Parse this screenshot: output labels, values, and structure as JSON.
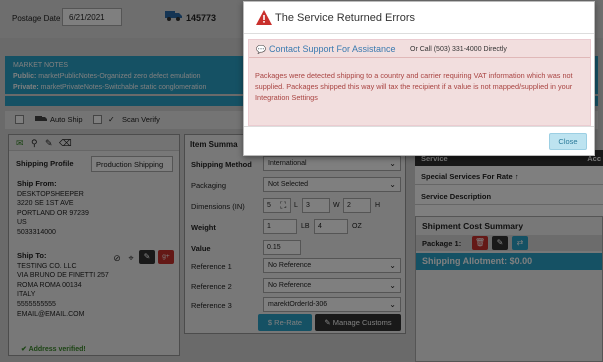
{
  "header": {
    "postage_date_label": "Postage Date",
    "postage_date_value": "6/21/2021",
    "order_number": "145773"
  },
  "market_notes": {
    "title": "MARKET NOTES",
    "public_label": "Public:",
    "public_text": "marketPublicNotes-Organized zero defect emulation",
    "private_label": "Private:",
    "private_text": "marketPrivateNotes-Switchable static conglomeration"
  },
  "options": {
    "auto_ship": "Auto Ship",
    "scan_verify": "Scan Verify"
  },
  "shipping": {
    "profile_label": "Shipping Profile",
    "profile_value": "Production Shipping",
    "ship_from_label": "Ship From:",
    "ship_from_lines": [
      "DESKTOPSHEEPER",
      "3220 SE 1ST AVE",
      "PORTLAND OR 97239",
      "US",
      "5033314000"
    ],
    "ship_to_label": "Ship To:",
    "ship_to_lines": [
      "TESTING CO. LLC",
      "VIA BRUNO DE FINETTI 257",
      "ROMA ROMA 00134",
      "ITALY",
      "5555555555",
      "EMAIL@EMAIL.COM"
    ],
    "verified_text": "Address verified!"
  },
  "item_summary": {
    "title": "Item Summa",
    "shipping_method_label": "Shipping Method",
    "shipping_method_value": "International",
    "packaging_label": "Packaging",
    "packaging_value": "Not Selected",
    "dimensions_label": "Dimensions (IN)",
    "dim_s": "5",
    "dim_l_label": "L",
    "dim_l": "3",
    "dim_w_label": "W",
    "dim_w": "2",
    "dim_h_label": "H",
    "weight_label": "Weight",
    "weight_lb": "1",
    "lb_label": "LB",
    "weight_oz": "4",
    "oz_label": "OZ",
    "value_label": "Value",
    "value_value": "0.15",
    "ref1_label": "Reference 1",
    "ref1_value": "No Reference",
    "ref2_label": "Reference 2",
    "ref2_value": "No Reference",
    "ref3_label": "Reference 3",
    "ref3_value": "marektOrderId-306",
    "rerate_label": "$ Re-Rate",
    "customs_label": "Manage Customs"
  },
  "services": {
    "head": "Service",
    "head_extra": "Acc",
    "special_label": "Special Services For Rate",
    "description_label": "Service Description"
  },
  "cost_summary": {
    "title": "Shipment Cost Summary",
    "package_label": "Package 1:",
    "allotment_text": "Shipping Allotment: $0.00"
  },
  "modal": {
    "title": "The Service Returned Errors",
    "support_link": "Contact Support For Assistance",
    "support_call": "Or Call (503) 331-4000 Directly",
    "message": "Packages were detected shipping to a country and carrier requiring VAT information which was not supplied. Packages shipped this way will tax the recipient if a value is not mapped/supplied in your Integration Settings",
    "close_label": "Close"
  },
  "colors": {
    "accent": "#2aa3c9",
    "error_bg": "#f2dede",
    "error_text": "#a94442",
    "warning_icon": "#c9302c"
  }
}
